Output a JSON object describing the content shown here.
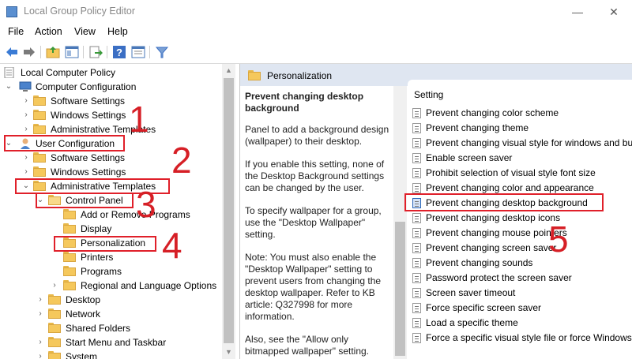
{
  "window": {
    "title": "Local Group Policy Editor",
    "minimize": "—",
    "close": "✕"
  },
  "menu": [
    "File",
    "Action",
    "View",
    "Help"
  ],
  "toolbar_icons": [
    "back-arrow-icon",
    "forward-arrow-icon",
    "up-folder-icon",
    "show-hide-tree-icon",
    "export-list-icon",
    "help-icon",
    "properties-icon",
    "filter-icon"
  ],
  "tree": {
    "items": [
      {
        "label": "Local Computer Policy",
        "icon": "computer-policy-icon"
      },
      {
        "label": "Computer Configuration",
        "icon": "computer-icon"
      },
      {
        "label": "Software Settings",
        "icon": "folder-icon"
      },
      {
        "label": "Windows Settings",
        "icon": "folder-icon"
      },
      {
        "label": "Administrative Templates",
        "icon": "folder-icon"
      },
      {
        "label": "User Configuration",
        "icon": "user-icon"
      },
      {
        "label": "Software Settings",
        "icon": "folder-icon"
      },
      {
        "label": "Windows Settings",
        "icon": "folder-icon"
      },
      {
        "label": "Administrative Templates",
        "icon": "folder-icon"
      },
      {
        "label": "Control Panel",
        "icon": "folder-open-icon"
      },
      {
        "label": "Add or Remove Programs",
        "icon": "folder-icon"
      },
      {
        "label": "Display",
        "icon": "folder-icon"
      },
      {
        "label": "Personalization",
        "icon": "folder-icon"
      },
      {
        "label": "Printers",
        "icon": "folder-icon"
      },
      {
        "label": "Programs",
        "icon": "folder-icon"
      },
      {
        "label": "Regional and Language Options",
        "icon": "folder-icon"
      },
      {
        "label": "Desktop",
        "icon": "folder-icon"
      },
      {
        "label": "Network",
        "icon": "folder-icon"
      },
      {
        "label": "Shared Folders",
        "icon": "folder-icon"
      },
      {
        "label": "Start Menu and Taskbar",
        "icon": "folder-icon"
      },
      {
        "label": "System",
        "icon": "folder-icon"
      }
    ]
  },
  "pane": {
    "header": "Personalization",
    "setting_title": "Prevent changing desktop background",
    "cut_line": "...",
    "paragraphs": [
      "Panel to add a background design (wallpaper) to their desktop.",
      "If you enable this setting, none of the Desktop Background settings can be changed by the user.",
      "To specify wallpaper for a group, use the \"Desktop Wallpaper\" setting.",
      "Note: You must also enable the \"Desktop Wallpaper\" setting to prevent users from changing the desktop wallpaper. Refer to KB article: Q327998 for more information.",
      "Also, see the \"Allow only bitmapped wallpaper\" setting."
    ]
  },
  "list": {
    "column": "Setting",
    "items": [
      "Prevent changing color scheme",
      "Prevent changing theme",
      "Prevent changing visual style for windows and buttons",
      "Enable screen saver",
      "Prohibit selection of visual style font size",
      "Prevent changing color and appearance",
      "Prevent changing desktop background",
      "Prevent changing desktop icons",
      "Prevent changing mouse pointers",
      "Prevent changing screen saver",
      "Prevent changing sounds",
      "Password protect the screen saver",
      "Screen saver timeout",
      "Force specific screen saver",
      "Load a specific theme",
      "Force a specific visual style file or force Windows Classic"
    ]
  },
  "annotations": [
    "1",
    "2",
    "3",
    "4",
    "5"
  ],
  "colors": {
    "highlight": "#e0202a",
    "header_bg": "#dfe6f1",
    "folder": "#f5c85c"
  }
}
